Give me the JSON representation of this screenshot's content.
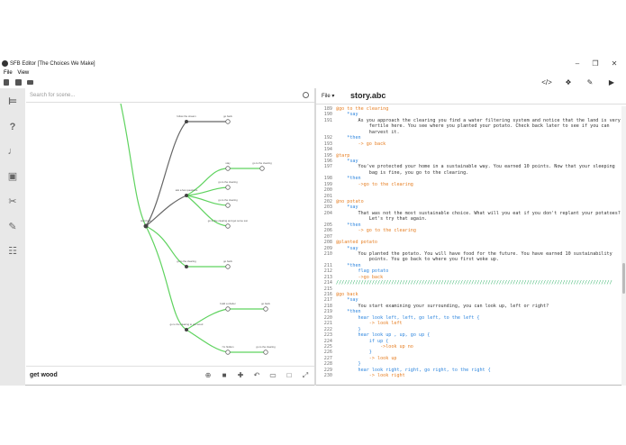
{
  "window": {
    "title": "SFB Editor [The Choices We Make]"
  },
  "menu": {
    "file": "File",
    "view": "View"
  },
  "search": {
    "placeholder": "Search for scene..."
  },
  "selected_scene": "get wood",
  "editor": {
    "file_menu": "File",
    "filename": "story.abc"
  },
  "graph": {
    "nodes": [
      {
        "label": "start here"
      },
      {
        "label": "follow the stream"
      },
      {
        "label": "go back"
      },
      {
        "label": "ask a few questions"
      },
      {
        "label": "stay"
      },
      {
        "label": "go to the clearing"
      },
      {
        "label": "go to the clearing"
      },
      {
        "label": "go to the clearing"
      },
      {
        "label": "go to the clearing and get some sun"
      },
      {
        "label": "go back"
      },
      {
        "label": "go to the clearing"
      },
      {
        "label": "go back"
      },
      {
        "label": "go to the clearing to get wood"
      },
      {
        "label": "build a shelter"
      },
      {
        "label": "go back"
      },
      {
        "label": "I'm hidden"
      },
      {
        "label": "go to the clearing"
      }
    ]
  },
  "code_lines": [
    {
      "n": "189",
      "segs": [
        {
          "t": "@go to the clearing",
          "c": "#e67e22"
        }
      ]
    },
    {
      "n": "190",
      "segs": [
        {
          "t": "    *say",
          "c": "#2e86de"
        }
      ]
    },
    {
      "n": "191",
      "segs": [
        {
          "t": "        As you approach the clearing you find a water filtering system and notice that the land is very",
          "c": "#333"
        }
      ]
    },
    {
      "n": "",
      "segs": [
        {
          "t": "            fertile here. You see where you planted your potato. Check back later to see if you can",
          "c": "#333"
        }
      ]
    },
    {
      "n": "",
      "segs": [
        {
          "t": "            harvest it.",
          "c": "#333"
        }
      ]
    },
    {
      "n": "192",
      "segs": [
        {
          "t": "    *then",
          "c": "#2e86de"
        }
      ]
    },
    {
      "n": "193",
      "segs": [
        {
          "t": "        -> go back",
          "c": "#e67e22"
        }
      ]
    },
    {
      "n": "194",
      "segs": [
        {
          "t": "",
          "c": "#333"
        }
      ]
    },
    {
      "n": "195",
      "segs": [
        {
          "t": "@tarp",
          "c": "#e67e22"
        }
      ]
    },
    {
      "n": "196",
      "segs": [
        {
          "t": "    *say",
          "c": "#2e86de"
        }
      ]
    },
    {
      "n": "197",
      "segs": [
        {
          "t": "        You've protected your home in a sustainable way. You earned 10 points. Now that your sleeping",
          "c": "#333"
        }
      ]
    },
    {
      "n": "",
      "segs": [
        {
          "t": "            bag is fine, you go to the clearing.",
          "c": "#333"
        }
      ]
    },
    {
      "n": "198",
      "segs": [
        {
          "t": "    *then",
          "c": "#2e86de"
        }
      ]
    },
    {
      "n": "199",
      "segs": [
        {
          "t": "        ->go to the clearing",
          "c": "#e67e22"
        }
      ]
    },
    {
      "n": "200",
      "segs": [
        {
          "t": "",
          "c": "#333"
        }
      ]
    },
    {
      "n": "201",
      "segs": [
        {
          "t": "",
          "c": "#333"
        }
      ]
    },
    {
      "n": "202",
      "segs": [
        {
          "t": "@no potato",
          "c": "#e67e22"
        }
      ]
    },
    {
      "n": "203",
      "segs": [
        {
          "t": "    *say",
          "c": "#2e86de"
        }
      ]
    },
    {
      "n": "204",
      "segs": [
        {
          "t": "        That was not the most sustainable choice. What will you eat if you don't replant your potatoes?",
          "c": "#333"
        }
      ]
    },
    {
      "n": "",
      "segs": [
        {
          "t": "            Let's try that again.",
          "c": "#333"
        }
      ]
    },
    {
      "n": "205",
      "segs": [
        {
          "t": "    *then",
          "c": "#2e86de"
        }
      ]
    },
    {
      "n": "206",
      "segs": [
        {
          "t": "        -> go to the clearing",
          "c": "#e67e22"
        }
      ]
    },
    {
      "n": "207",
      "segs": [
        {
          "t": "",
          "c": "#333"
        }
      ]
    },
    {
      "n": "208",
      "segs": [
        {
          "t": "@planted potato",
          "c": "#e67e22"
        }
      ]
    },
    {
      "n": "209",
      "segs": [
        {
          "t": "    *say",
          "c": "#2e86de"
        }
      ]
    },
    {
      "n": "210",
      "segs": [
        {
          "t": "        You planted the potato. You will have food for the future. You have earned 10 sustainability",
          "c": "#333"
        }
      ]
    },
    {
      "n": "",
      "segs": [
        {
          "t": "            points. You go back to where you first woke up.",
          "c": "#333"
        }
      ]
    },
    {
      "n": "211",
      "segs": [
        {
          "t": "    *then",
          "c": "#2e86de"
        }
      ]
    },
    {
      "n": "212",
      "segs": [
        {
          "t": "        flag potato",
          "c": "#2e86de"
        }
      ]
    },
    {
      "n": "213",
      "segs": [
        {
          "t": "        ->go back",
          "c": "#e67e22"
        }
      ]
    },
    {
      "n": "214",
      "segs": [
        {
          "t": "////////////////////////////////////////////////////////////////////////////////////////////////////",
          "c": "#27ae60"
        }
      ]
    },
    {
      "n": "215",
      "segs": [
        {
          "t": "",
          "c": "#333"
        }
      ]
    },
    {
      "n": "216",
      "segs": [
        {
          "t": "@go back",
          "c": "#e67e22"
        }
      ]
    },
    {
      "n": "217",
      "segs": [
        {
          "t": "    *say",
          "c": "#2e86de"
        }
      ]
    },
    {
      "n": "218",
      "segs": [
        {
          "t": "        You start examining your surrounding, you can look up, left or right?",
          "c": "#333"
        }
      ]
    },
    {
      "n": "219",
      "segs": [
        {
          "t": "    *then",
          "c": "#2e86de"
        }
      ]
    },
    {
      "n": "220",
      "segs": [
        {
          "t": "        hear look left, left, go left, to the left {",
          "c": "#2e86de"
        }
      ]
    },
    {
      "n": "221",
      "segs": [
        {
          "t": "            -> look left",
          "c": "#e67e22"
        }
      ]
    },
    {
      "n": "222",
      "segs": [
        {
          "t": "        }",
          "c": "#2e86de"
        }
      ]
    },
    {
      "n": "223",
      "segs": [
        {
          "t": "        hear look up , up, go up {",
          "c": "#2e86de"
        }
      ]
    },
    {
      "n": "224",
      "segs": [
        {
          "t": "            if up {",
          "c": "#2e86de"
        }
      ]
    },
    {
      "n": "225",
      "segs": [
        {
          "t": "                ->look up no",
          "c": "#e67e22"
        }
      ]
    },
    {
      "n": "226",
      "segs": [
        {
          "t": "            }",
          "c": "#2e86de"
        }
      ]
    },
    {
      "n": "227",
      "segs": [
        {
          "t": "            -> look up",
          "c": "#e67e22"
        }
      ]
    },
    {
      "n": "228",
      "segs": [
        {
          "t": "        }",
          "c": "#2e86de"
        }
      ]
    },
    {
      "n": "229",
      "segs": [
        {
          "t": "        hear look right, right, go right, to the right {",
          "c": "#2e86de"
        }
      ]
    },
    {
      "n": "230",
      "segs": [
        {
          "t": "            -> look right",
          "c": "#e67e22"
        }
      ]
    }
  ]
}
